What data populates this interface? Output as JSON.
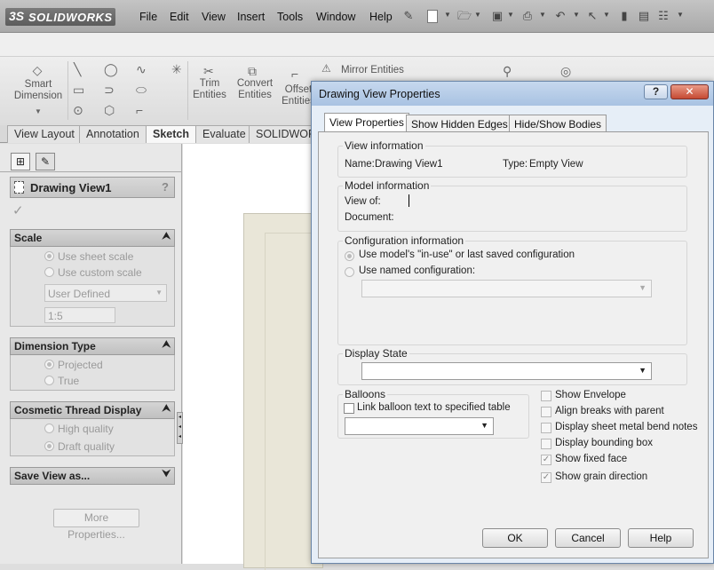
{
  "app": {
    "logo_mark": "3S",
    "logo_text": "SOLIDWORKS"
  },
  "menu": [
    "File",
    "Edit",
    "View",
    "Insert",
    "Tools",
    "Window",
    "Help"
  ],
  "ribbon": {
    "smart_dimension": "Smart Dimension",
    "trim_entities": "Trim Entities",
    "convert_entities": "Convert Entities",
    "offset_entities": "Offset Entities",
    "mirror_entities": "Mirror Entities"
  },
  "cm_tabs": [
    "View Layout",
    "Annotation",
    "Sketch",
    "Evaluate",
    "SOLIDWORKS"
  ],
  "cm_active_tab": "Sketch",
  "property_manager": {
    "title": "Drawing View1",
    "help": "?",
    "scale": {
      "header": "Scale",
      "use_sheet_scale": "Use sheet scale",
      "use_custom_scale": "Use custom scale",
      "custom_select": "User Defined",
      "ratio": "1:5"
    },
    "dimension_type": {
      "header": "Dimension Type",
      "projected": "Projected",
      "true": "True"
    },
    "cosmetic_thread": {
      "header": "Cosmetic Thread Display",
      "high_quality": "High quality",
      "draft_quality": "Draft quality"
    },
    "save_view": {
      "header": "Save View as..."
    },
    "more_properties": "More Properties..."
  },
  "dialog": {
    "title": "Drawing View Properties",
    "help_btn": "?",
    "close_btn": "✕",
    "tabs": [
      "View Properties",
      "Show Hidden Edges",
      "Hide/Show Bodies"
    ],
    "view_information": {
      "title": "View information",
      "name_label": "Name:",
      "name_value": "Drawing View1",
      "type_label": "Type:",
      "type_value": "Empty View"
    },
    "model_information": {
      "title": "Model information",
      "view_of_label": "View of:",
      "view_of_value": "",
      "document_label": "Document:",
      "document_value": ""
    },
    "configuration_information": {
      "title": "Configuration information",
      "option_in_use": "Use model's \"in-use\" or last saved configuration",
      "option_named": "Use named configuration:",
      "selected_configuration": ""
    },
    "display_state": {
      "title": "Display State",
      "selected": ""
    },
    "balloons": {
      "title": "Balloons",
      "link_checkbox": "Link balloon text to specified table",
      "link_checked": false,
      "table_selected": ""
    },
    "options": [
      {
        "label": "Show Envelope",
        "checked": false
      },
      {
        "label": "Align breaks with parent",
        "checked": false
      },
      {
        "label": "Display sheet metal bend notes",
        "checked": false
      },
      {
        "label": "Display bounding box",
        "checked": false
      },
      {
        "label": "Show fixed face",
        "checked": true
      },
      {
        "label": "Show grain direction",
        "checked": true
      }
    ],
    "buttons": {
      "ok": "OK",
      "cancel": "Cancel",
      "help": "Help"
    }
  }
}
